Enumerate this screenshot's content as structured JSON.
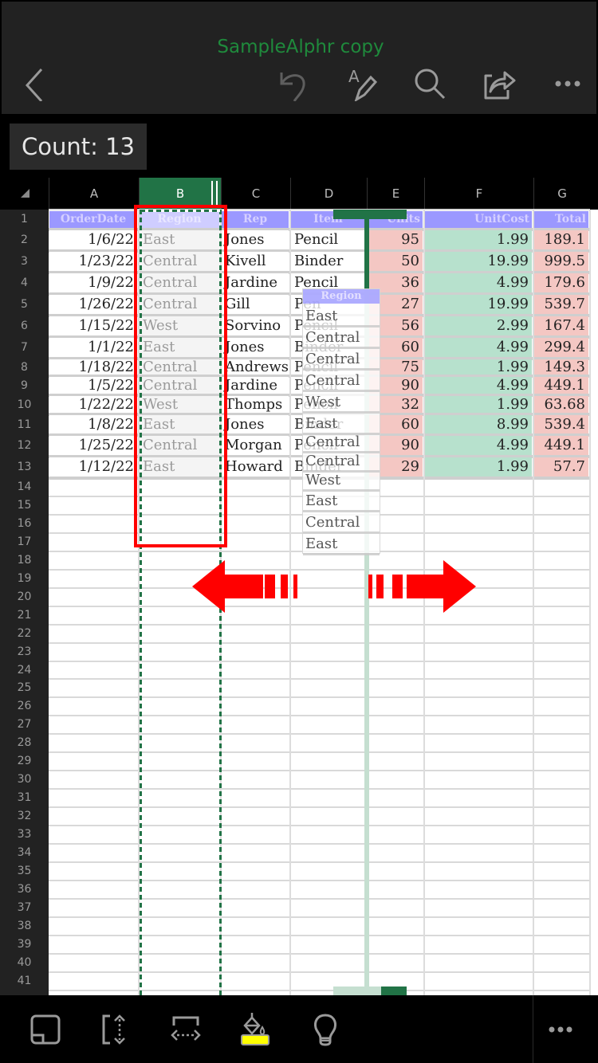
{
  "app": {
    "title": "SampleAlphr copy",
    "accent_color": "#1f8a3c",
    "selection_color": "#217346"
  },
  "toolbar": {
    "back": "back-icon",
    "undo": "undo-icon",
    "draw": "draw-icon",
    "search": "search-icon",
    "share": "share-icon",
    "more": "more-icon"
  },
  "status": {
    "count_label": "Count: 13"
  },
  "sheet": {
    "columns": [
      "A",
      "B",
      "C",
      "D",
      "E",
      "F",
      "G"
    ],
    "selected_column": "B",
    "header_row": [
      "OrderDate",
      "Region",
      "Rep",
      "Item",
      "Units",
      "UnitCost",
      "Total"
    ],
    "rows": [
      [
        "1/6/22",
        "East",
        "Jones",
        "Pencil",
        "95",
        "1.99",
        "189.1"
      ],
      [
        "1/23/22",
        "Central",
        "Kivell",
        "Binder",
        "50",
        "19.99",
        "999.5"
      ],
      [
        "1/9/22",
        "Central",
        "Jardine",
        "Pencil",
        "36",
        "4.99",
        "179.6"
      ],
      [
        "1/26/22",
        "Central",
        "Gill",
        "Pen",
        "27",
        "19.99",
        "539.7"
      ],
      [
        "1/15/22",
        "West",
        "Sorvino",
        "Pencil",
        "56",
        "2.99",
        "167.4"
      ],
      [
        "1/1/22",
        "East",
        "Jones",
        "Binder",
        "60",
        "4.99",
        "299.4"
      ],
      [
        "1/18/22",
        "Central",
        "Andrews",
        "Pencil",
        "75",
        "1.99",
        "149.3"
      ],
      [
        "1/5/22",
        "Central",
        "Jardine",
        "Pencil",
        "90",
        "4.99",
        "449.1"
      ],
      [
        "1/22/22",
        "West",
        "Thomps",
        "Pencil",
        "32",
        "1.99",
        "63.68"
      ],
      [
        "1/8/22",
        "East",
        "Jones",
        "Binder",
        "60",
        "8.99",
        "539.4"
      ],
      [
        "1/25/22",
        "Central",
        "Morgan",
        "Pencil",
        "90",
        "4.99",
        "449.1"
      ],
      [
        "1/12/22",
        "East",
        "Howard",
        "Binder",
        "29",
        "1.99",
        "57.7"
      ]
    ],
    "row_numbers": [
      "1",
      "2",
      "3",
      "4",
      "5",
      "6",
      "7",
      "8",
      "9",
      "10",
      "11",
      "12",
      "13",
      "14",
      "15",
      "16",
      "17",
      "18",
      "19",
      "20",
      "21",
      "22",
      "23",
      "24",
      "25",
      "26",
      "27",
      "28",
      "29",
      "30",
      "31",
      "32",
      "33",
      "34",
      "35",
      "36",
      "37",
      "38",
      "39",
      "40",
      "41"
    ],
    "drag_preview": {
      "header": "Region",
      "values": [
        "East",
        "Central",
        "Central",
        "Central",
        "West",
        "East",
        "Central",
        "Central",
        "West",
        "East",
        "Central",
        "East"
      ]
    },
    "colors": {
      "header_fill": "#9b98ff",
      "units_fill": "#f4c7c3",
      "unitcost_fill": "#b7e1cd",
      "total_fill": "#f4c7c3",
      "annotation_red": "#ff0000"
    }
  },
  "bottom_toolbar": {
    "items": [
      "sheet-view-icon",
      "row-resize-icon",
      "column-resize-icon",
      "fill-color-icon",
      "lightbulb-icon"
    ],
    "fill_color": "#ffff00",
    "more": "more-icon"
  }
}
